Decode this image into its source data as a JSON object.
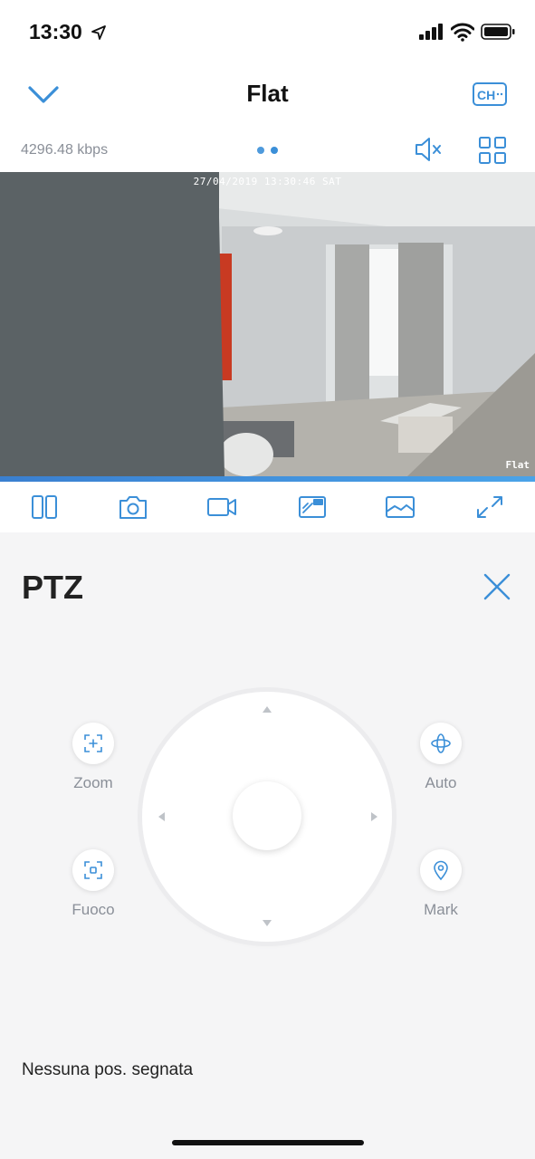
{
  "status_bar": {
    "time": "13:30"
  },
  "nav": {
    "title": "Flat",
    "channel_button_label": "CH"
  },
  "stream": {
    "bitrate": "4296.48 kbps"
  },
  "video": {
    "osd_timestamp": "27/04/2019 13:30:46 SAT",
    "camera_name": "Flat"
  },
  "toolbar": {
    "buttons": [
      "split-view",
      "snapshot",
      "record",
      "hd-quality",
      "gallery",
      "fullscreen"
    ]
  },
  "ptz": {
    "title": "PTZ",
    "zoom_label": "Zoom",
    "focus_label": "Fuoco",
    "auto_label": "Auto",
    "mark_label": "Mark",
    "no_position": "Nessuna pos. segnata"
  },
  "colors": {
    "accent": "#3b8fd8",
    "muted_text": "#8a8f98",
    "panel_bg": "#f5f5f6"
  }
}
